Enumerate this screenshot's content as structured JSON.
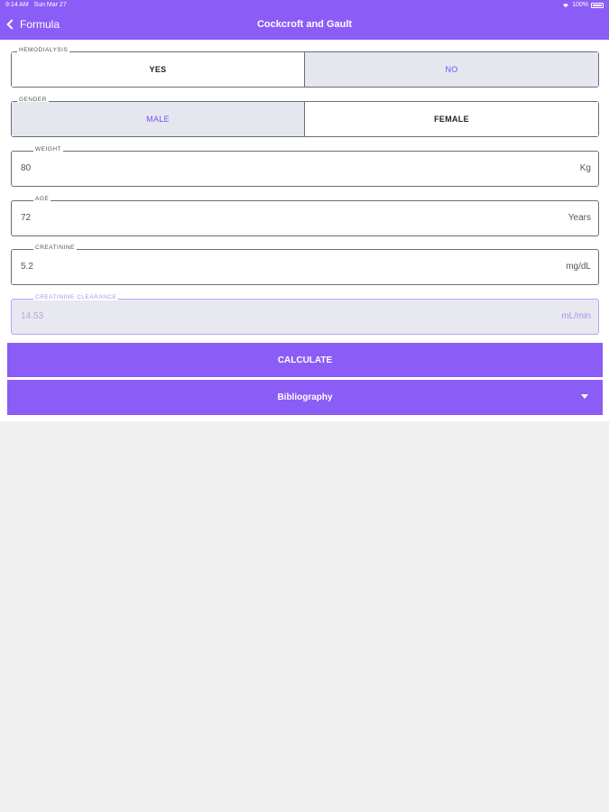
{
  "status_bar": {
    "time": "9:14 AM",
    "date": "Sun Mar 27",
    "battery": "100%"
  },
  "nav": {
    "back_label": "Formula",
    "title": "Cockcroft and Gault"
  },
  "hemodialysis": {
    "label": "HEMODIALYSIS",
    "options": [
      "YES",
      "NO"
    ],
    "selected": "NO"
  },
  "gender": {
    "label": "GENDER",
    "options": [
      "MALE",
      "FEMALE"
    ],
    "selected": "MALE"
  },
  "fields": {
    "weight": {
      "label": "WEIGHT",
      "value": "80",
      "unit": "Kg"
    },
    "age": {
      "label": "AGE",
      "value": "72",
      "unit": "Years"
    },
    "creatinine": {
      "label": "CREATININE",
      "value": "5.2",
      "unit": "mg/dL"
    },
    "clearance": {
      "label": "CREATININE CLEARANCE",
      "value": "14.53",
      "unit": "mL/min"
    }
  },
  "buttons": {
    "calculate": "CALCULATE",
    "bibliography": "Bibliography"
  },
  "colors": {
    "accent": "#8b5cf6",
    "selected_bg": "#e5e7ee",
    "selected_text": "#7c4dff",
    "page_bg": "#f0f0f0"
  },
  "icons": {
    "back": "chevron-left-icon",
    "expand": "chevron-down-icon",
    "wifi": "wifi-icon",
    "battery": "battery-icon"
  }
}
